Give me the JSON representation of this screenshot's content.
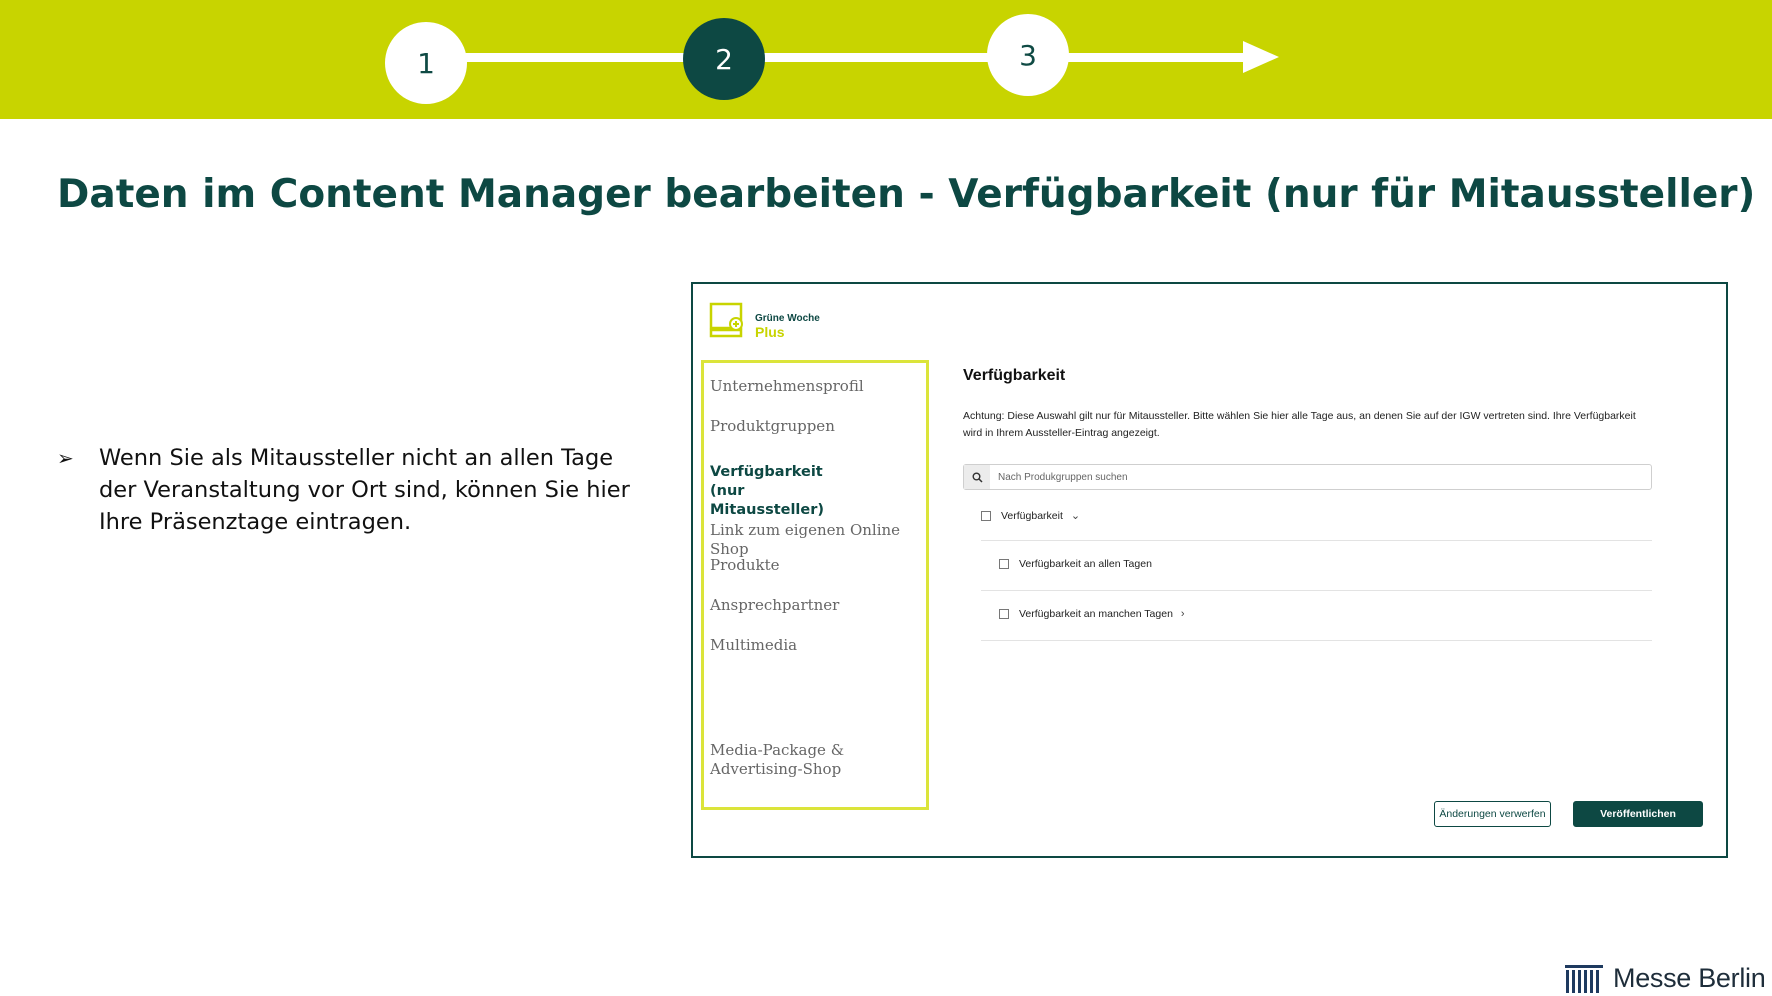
{
  "steps": [
    {
      "label": "1",
      "state": "inactive"
    },
    {
      "label": "2",
      "state": "active"
    },
    {
      "label": "3",
      "state": "inactive"
    }
  ],
  "title": "Daten im Content Manager bearbeiten - Verfügbarkeit (nur für Mitaussteller)",
  "bullet": {
    "icon": "arrowhead-bullet-icon",
    "text": "Wenn Sie als Mitaussteller nicht an allen Tage der Veranstaltung vor Ort sind, können Sie hier Ihre Präsenztage eintragen."
  },
  "screenshot": {
    "logo": {
      "line1": "Grüne Woche",
      "line2": "Plus"
    },
    "nav": [
      {
        "label": "Unternehmensprofil",
        "active": false
      },
      {
        "label": "Produktgruppen",
        "active": false
      },
      {
        "label": "Verfügbarkeit (nur Mitaussteller)",
        "active": true
      },
      {
        "label": "Link zum eigenen Online Shop",
        "active": false
      },
      {
        "label": "Produkte",
        "active": false
      },
      {
        "label": "Ansprechpartner",
        "active": false
      },
      {
        "label": "Multimedia",
        "active": false
      },
      {
        "label": "Media-Package & Advertising-Shop",
        "active": false
      }
    ],
    "main_title": "Verfügbarkeit",
    "note": "Achtung: Diese Auswahl gilt nur für Mitaussteller. Bitte wählen Sie hier alle Tage aus, an denen Sie auf der IGW vertreten sind. Ihre Verfügbarkeit wird in Ihrem Aussteller-Eintrag angezeigt.",
    "search_placeholder": "Nach Produkgruppen suchen",
    "options": [
      {
        "label": "Verfügbarkeit",
        "checked": false,
        "icon": "chevron-down-icon"
      },
      {
        "label": "Verfügbarkeit an allen Tagen",
        "checked": false
      },
      {
        "label": "Verfügbarkeit an manchen Tagen",
        "checked": false,
        "icon": "chevron-right-icon"
      }
    ],
    "discard_button": "Änderungen verwerfen",
    "publish_button": "Veröffentlichen"
  },
  "brand": "Messe Berlin",
  "colors": {
    "accent": "#c8d400",
    "primary": "#0d4843"
  }
}
